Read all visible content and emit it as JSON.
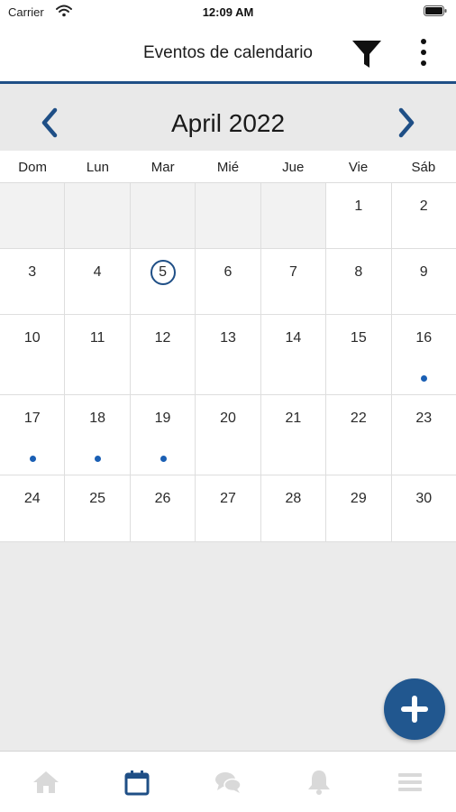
{
  "status_bar": {
    "carrier": "Carrier",
    "time": "12:09 AM"
  },
  "header": {
    "title": "Eventos de calendario"
  },
  "calendar": {
    "month_label": "April 2022",
    "weekdays": [
      "Dom",
      "Lun",
      "Mar",
      "Mié",
      "Jue",
      "Vie",
      "Sáb"
    ],
    "today": 5,
    "weeks": [
      [
        "",
        "",
        "",
        "",
        "",
        "1",
        "2"
      ],
      [
        "3",
        "4",
        "5",
        "6",
        "7",
        "8",
        "9"
      ],
      [
        "10",
        "11",
        "12",
        "13",
        "14",
        "15",
        "16"
      ],
      [
        "17",
        "18",
        "19",
        "20",
        "21",
        "22",
        "23"
      ],
      [
        "24",
        "25",
        "26",
        "27",
        "28",
        "29",
        "30"
      ]
    ],
    "event_days": [
      16,
      17,
      18,
      19
    ]
  },
  "tabs": [
    {
      "name": "home",
      "icon": "home-icon",
      "active": false
    },
    {
      "name": "calendar",
      "icon": "calendar-icon",
      "active": true
    },
    {
      "name": "messages",
      "icon": "chat-icon",
      "active": false
    },
    {
      "name": "notifications",
      "icon": "bell-icon",
      "active": false
    },
    {
      "name": "menu",
      "icon": "menu-icon",
      "active": false
    }
  ],
  "colors": {
    "accent": "#1f4f86",
    "event_dot": "#1a5fb4",
    "inactive_icon": "#d9d9d9"
  }
}
